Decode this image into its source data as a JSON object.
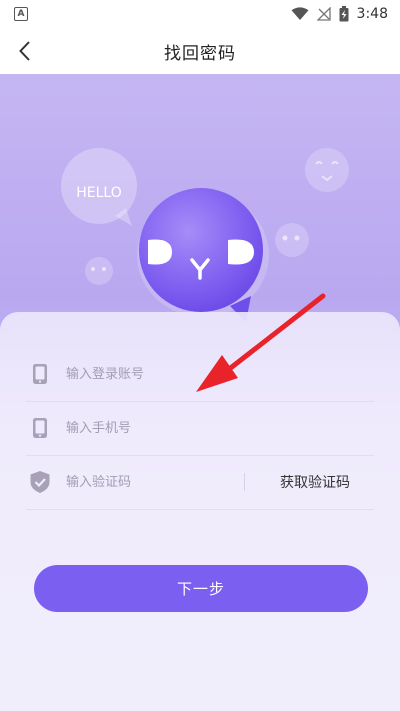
{
  "status_bar": {
    "notification_icon": "A",
    "time": "3:48",
    "icons": [
      "wifi-icon",
      "no-signal-icon",
      "battery-charging-icon"
    ]
  },
  "header": {
    "title": "找回密码",
    "back_icon": "chevron-left-icon"
  },
  "hero": {
    "hello_text": "HELLO",
    "logo_icon": "dyd-chat-bubble-icon"
  },
  "form": {
    "account_placeholder": "输入登录账号",
    "phone_placeholder": "输入手机号",
    "code_placeholder": "输入验证码",
    "get_code_label": "获取验证码",
    "account_icon": "phone-icon",
    "phone_icon": "phone-icon",
    "code_icon": "shield-check-icon"
  },
  "next_button_label": "下一步",
  "annotation": {
    "icon": "red-arrow-icon",
    "color": "#e8232a"
  },
  "colors": {
    "accent": "#7b5ff0",
    "hero_background": "#bcaef1",
    "card_background": "#efebfc"
  }
}
